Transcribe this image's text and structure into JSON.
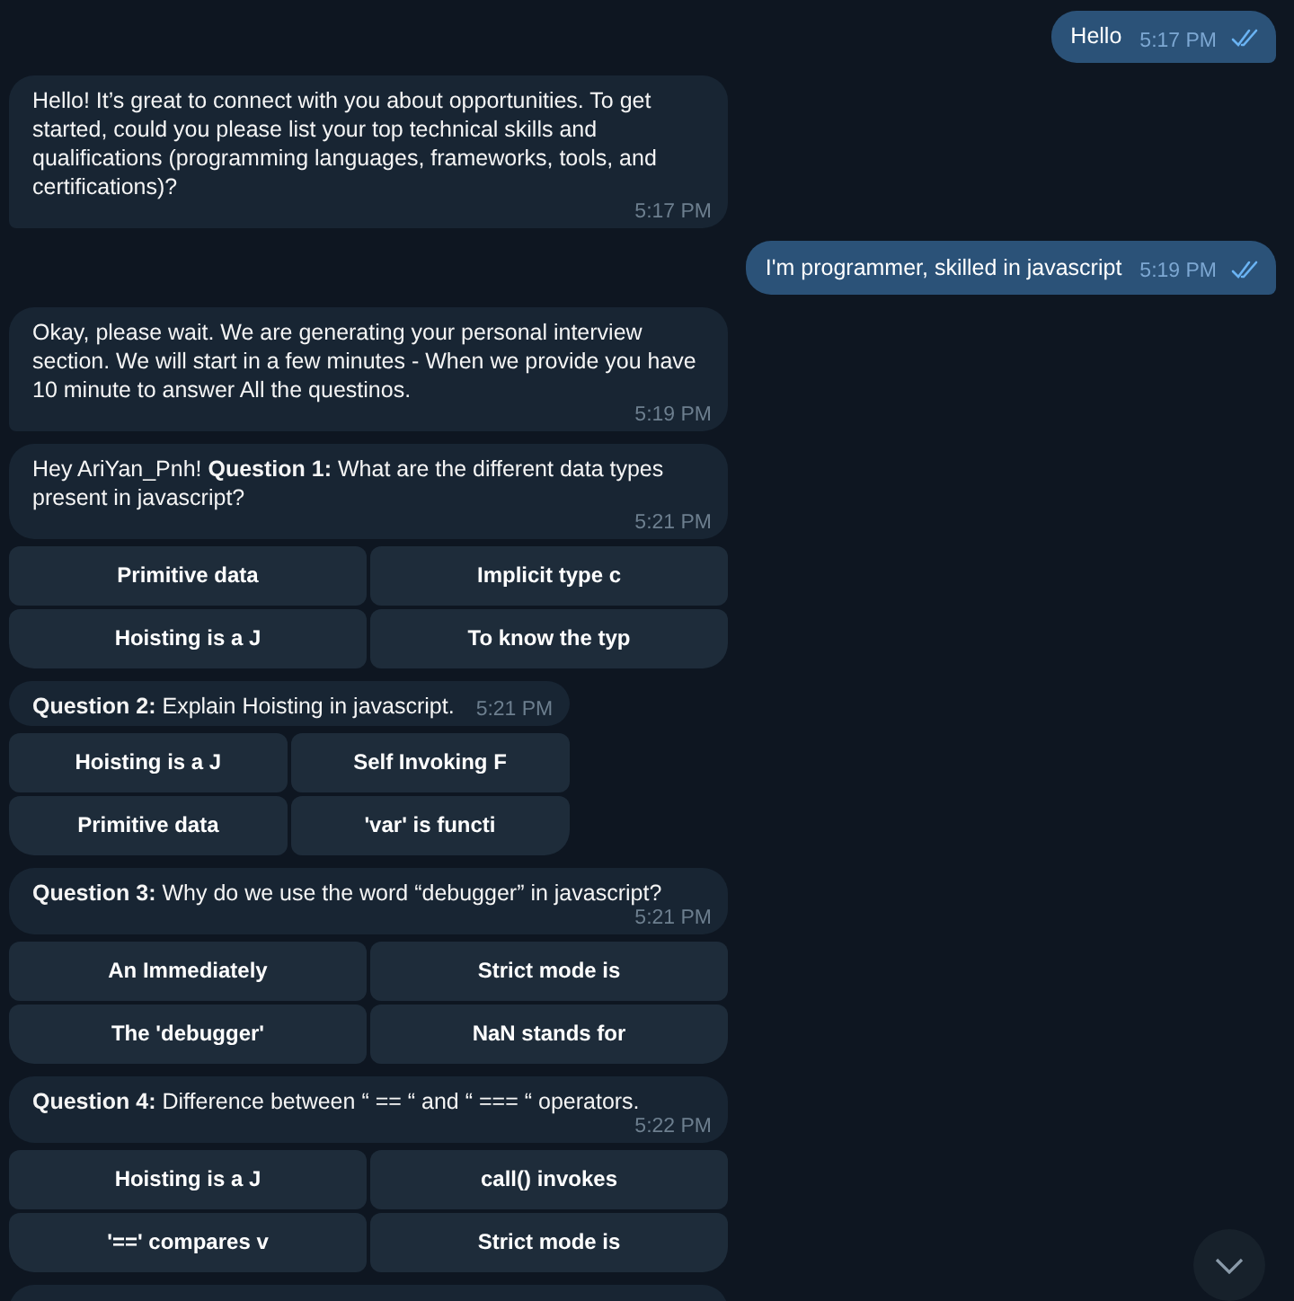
{
  "messages": [
    {
      "kind": "out",
      "text": "Hello",
      "time": "5:17 PM",
      "read": true
    },
    {
      "kind": "in",
      "text": "Hello! It’s great to connect with you about opportunities. To get started, could you please list your top technical skills and qualifications (programming languages, frameworks, tools, and certifications)?",
      "time": "5:17 PM"
    },
    {
      "kind": "out",
      "text": "I'm programmer, skilled in javascript",
      "time": "5:19 PM",
      "read": true
    },
    {
      "kind": "in",
      "text": "Okay, please wait. We are generating your personal interview section. We will start in a few minutes - When we provide you have 10 minute to answer All the questinos.",
      "time": "5:19 PM"
    },
    {
      "kind": "quiz",
      "text": "Hey AriYan_Pnh! **Question 1:** What are the different data types present in javascript?",
      "time": "5:21 PM",
      "buttons": [
        [
          "Primitive data",
          "Implicit type c"
        ],
        [
          "Hoisting is a J",
          "To know the typ"
        ]
      ]
    },
    {
      "kind": "quiz",
      "text": "**Question 2:** Explain Hoisting in javascript.",
      "time": "5:21 PM",
      "buttons": [
        [
          "Hoisting is a J",
          "Self Invoking F"
        ],
        [
          "Primitive data",
          "'var' is functi"
        ]
      ]
    },
    {
      "kind": "quiz",
      "text": "**Question 3:** Why do we use the word “debugger” in javascript?",
      "time": "5:21 PM",
      "buttons": [
        [
          "An Immediately",
          "Strict mode is"
        ],
        [
          "The 'debugger'",
          "NaN stands for"
        ]
      ]
    },
    {
      "kind": "quiz",
      "text": "**Question 4:** Difference between “ == “ and “ === “ operators.",
      "time": "5:22 PM",
      "buttons": [
        [
          "Hoisting is a J",
          "call() invokes"
        ],
        [
          "'==' compares v",
          "Strict mode is"
        ]
      ]
    },
    {
      "kind": "partial"
    }
  ]
}
